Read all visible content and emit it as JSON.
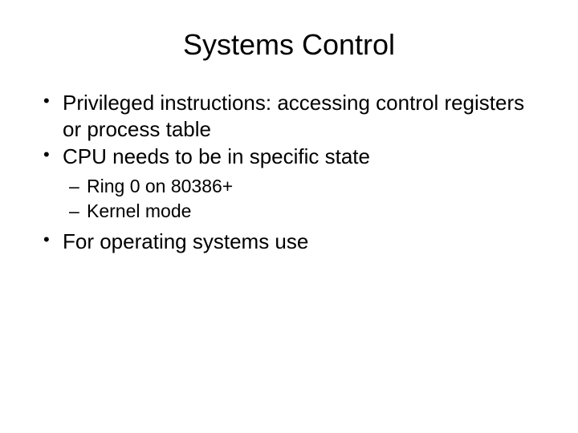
{
  "title": "Systems Control",
  "bullets": {
    "b1": "Privileged instructions: accessing control registers or process table",
    "b2": "CPU needs to be in specific state",
    "b2_1": "Ring 0 on 80386+",
    "b2_2": "Kernel mode",
    "b3": "For operating systems use"
  }
}
